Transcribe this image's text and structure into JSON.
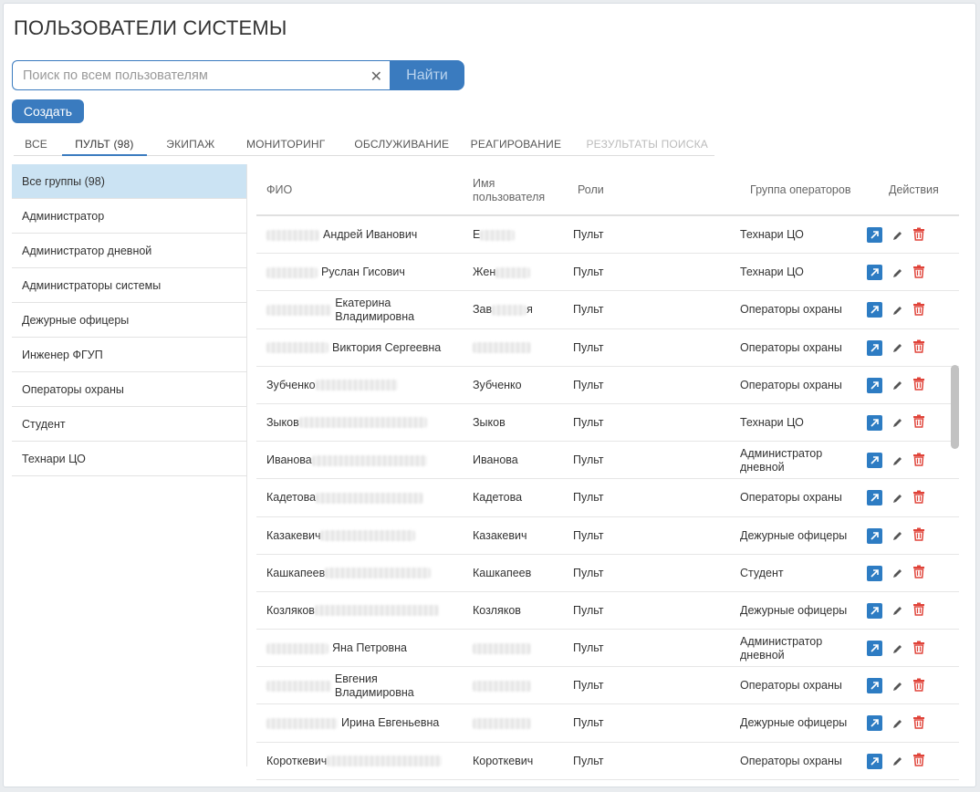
{
  "page": {
    "title": "ПОЛЬЗОВАТЕЛИ СИСТЕМЫ"
  },
  "search": {
    "placeholder": "Поиск по всем пользователям",
    "value": "",
    "clear_icon": "close-icon",
    "button_label": "Найти"
  },
  "toolbar": {
    "create_label": "Создать"
  },
  "tabs": [
    {
      "label": "ВСЕ",
      "state": "normal"
    },
    {
      "label": "ПУЛЬТ (98)",
      "state": "active"
    },
    {
      "label": "ЭКИПАЖ",
      "state": "normal"
    },
    {
      "label": "МОНИТОРИНГ",
      "state": "normal"
    },
    {
      "label": "ОБСЛУЖИВАНИЕ",
      "state": "normal"
    },
    {
      "label": "РЕАГИРОВАНИЕ",
      "state": "normal"
    },
    {
      "label": "РЕЗУЛЬТАТЫ ПОИСКА",
      "state": "disabled"
    }
  ],
  "sidebar": {
    "items": [
      {
        "label": "Все группы (98)",
        "active": true
      },
      {
        "label": "Администратор"
      },
      {
        "label": "Администратор дневной"
      },
      {
        "label": "Администраторы системы"
      },
      {
        "label": "Дежурные офицеры"
      },
      {
        "label": "Инженер ФГУП"
      },
      {
        "label": "Операторы охраны"
      },
      {
        "label": "Студент"
      },
      {
        "label": "Технари ЦО"
      }
    ]
  },
  "table": {
    "columns": {
      "fio": "ФИО",
      "username": "Имя пользователя",
      "roles": "Роли",
      "group": "Группа операторов",
      "actions": "Действия"
    },
    "rows": [
      {
        "fio_visible": "Андрей Иванович",
        "fio_blur": "prefix",
        "username_visible": "Е",
        "role": "Пульт",
        "group": "Технари ЦО"
      },
      {
        "fio_visible": "Руслан Гисович",
        "fio_blur": "prefix",
        "username_visible": "Жен",
        "role": "Пульт",
        "group": "Технари ЦО"
      },
      {
        "fio_visible": "Екатерина Владимировна",
        "fio_blur": "prefix",
        "username_visible": "Зав",
        "username_suffix": "я",
        "role": "Пульт",
        "group": "Операторы охраны"
      },
      {
        "fio_visible": "Виктория Сергеевна",
        "fio_blur": "prefix",
        "username_visible": "",
        "role": "Пульт",
        "group": "Операторы охраны"
      },
      {
        "fio_visible": "Зубченко",
        "fio_blur": "suffix",
        "username_visible": "Зубченко",
        "role": "Пульт",
        "group": "Операторы охраны"
      },
      {
        "fio_visible": "Зыков",
        "fio_blur": "suffix",
        "username_visible": "Зыков",
        "role": "Пульт",
        "group": "Технари ЦО"
      },
      {
        "fio_visible": "Иванова",
        "fio_blur": "suffix",
        "username_visible": "Иванова",
        "role": "Пульт",
        "group": "Администратор дневной"
      },
      {
        "fio_visible": "Кадетова",
        "fio_blur": "suffix",
        "username_visible": "Кадетова",
        "role": "Пульт",
        "group": "Операторы охраны"
      },
      {
        "fio_visible": "Казакевич",
        "fio_blur": "suffix",
        "username_visible": "Казакевич",
        "role": "Пульт",
        "group": "Дежурные офицеры"
      },
      {
        "fio_visible": "Кашкапеев",
        "fio_blur": "suffix",
        "username_visible": "Кашкапеев",
        "role": "Пульт",
        "group": "Студент"
      },
      {
        "fio_visible": "Козляков",
        "fio_blur": "suffix",
        "username_visible": "Козляков",
        "role": "Пульт",
        "group": "Дежурные офицеры"
      },
      {
        "fio_visible": "Яна Петровна",
        "fio_blur": "prefix",
        "username_visible": "",
        "role": "Пульт",
        "group": "Администратор дневной"
      },
      {
        "fio_visible": "Евгения Владимировна",
        "fio_blur": "prefix",
        "username_visible": "",
        "role": "Пульт",
        "group": "Операторы охраны"
      },
      {
        "fio_visible": "Ирина Евгеньевна",
        "fio_blur": "prefix",
        "username_visible": "",
        "role": "Пульт",
        "group": "Дежурные офицеры"
      },
      {
        "fio_visible": "Короткевич",
        "fio_blur": "suffix",
        "username_visible": "Короткевич",
        "role": "Пульт",
        "group": "Операторы охраны"
      }
    ],
    "action_icons": [
      "open-external-icon",
      "pencil-icon",
      "trash-icon"
    ]
  },
  "colors": {
    "accent": "#3a7bbf",
    "active_bg": "#cbe3f3",
    "delete": "#e0443a"
  }
}
